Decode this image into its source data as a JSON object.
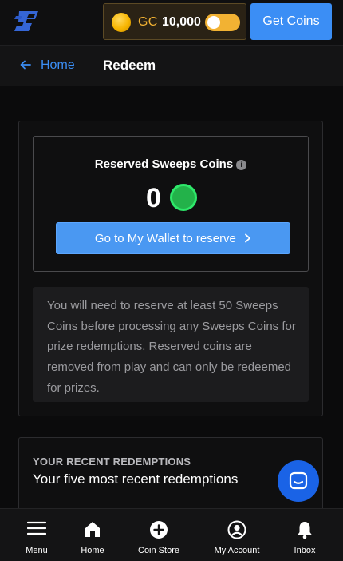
{
  "header": {
    "logo_icon": "brand-logo-icon",
    "currency_label": "GC",
    "balance": "10,000",
    "get_coins_label": "Get Coins",
    "toggle_state": "off"
  },
  "breadcrumb": {
    "home_label": "Home",
    "current_label": "Redeem"
  },
  "reserved": {
    "title": "Reserved Sweeps Coins",
    "amount": "0",
    "wallet_button_label": "Go to My Wallet to reserve",
    "notice": "You will need to reserve at least 50 Sweeps Coins before processing any Sweeps Coins for prize redemptions. Reserved coins are removed from play and can only be redeemed for prizes."
  },
  "recent": {
    "caption": "YOUR RECENT REDEMPTIONS",
    "title": "Your five most recent redemptions"
  },
  "nav": {
    "items": [
      {
        "label": "Menu",
        "icon": "hamburger-icon"
      },
      {
        "label": "Home",
        "icon": "home-icon"
      },
      {
        "label": "Coin Store",
        "icon": "plus-circle-icon"
      },
      {
        "label": "My Account",
        "icon": "user-icon"
      },
      {
        "label": "Inbox",
        "icon": "bell-icon"
      }
    ]
  },
  "colors": {
    "accent": "#3b8ef5",
    "gold": "#f2b233",
    "sweeps_green": "#23b24a",
    "background": "#0b0b0c"
  }
}
